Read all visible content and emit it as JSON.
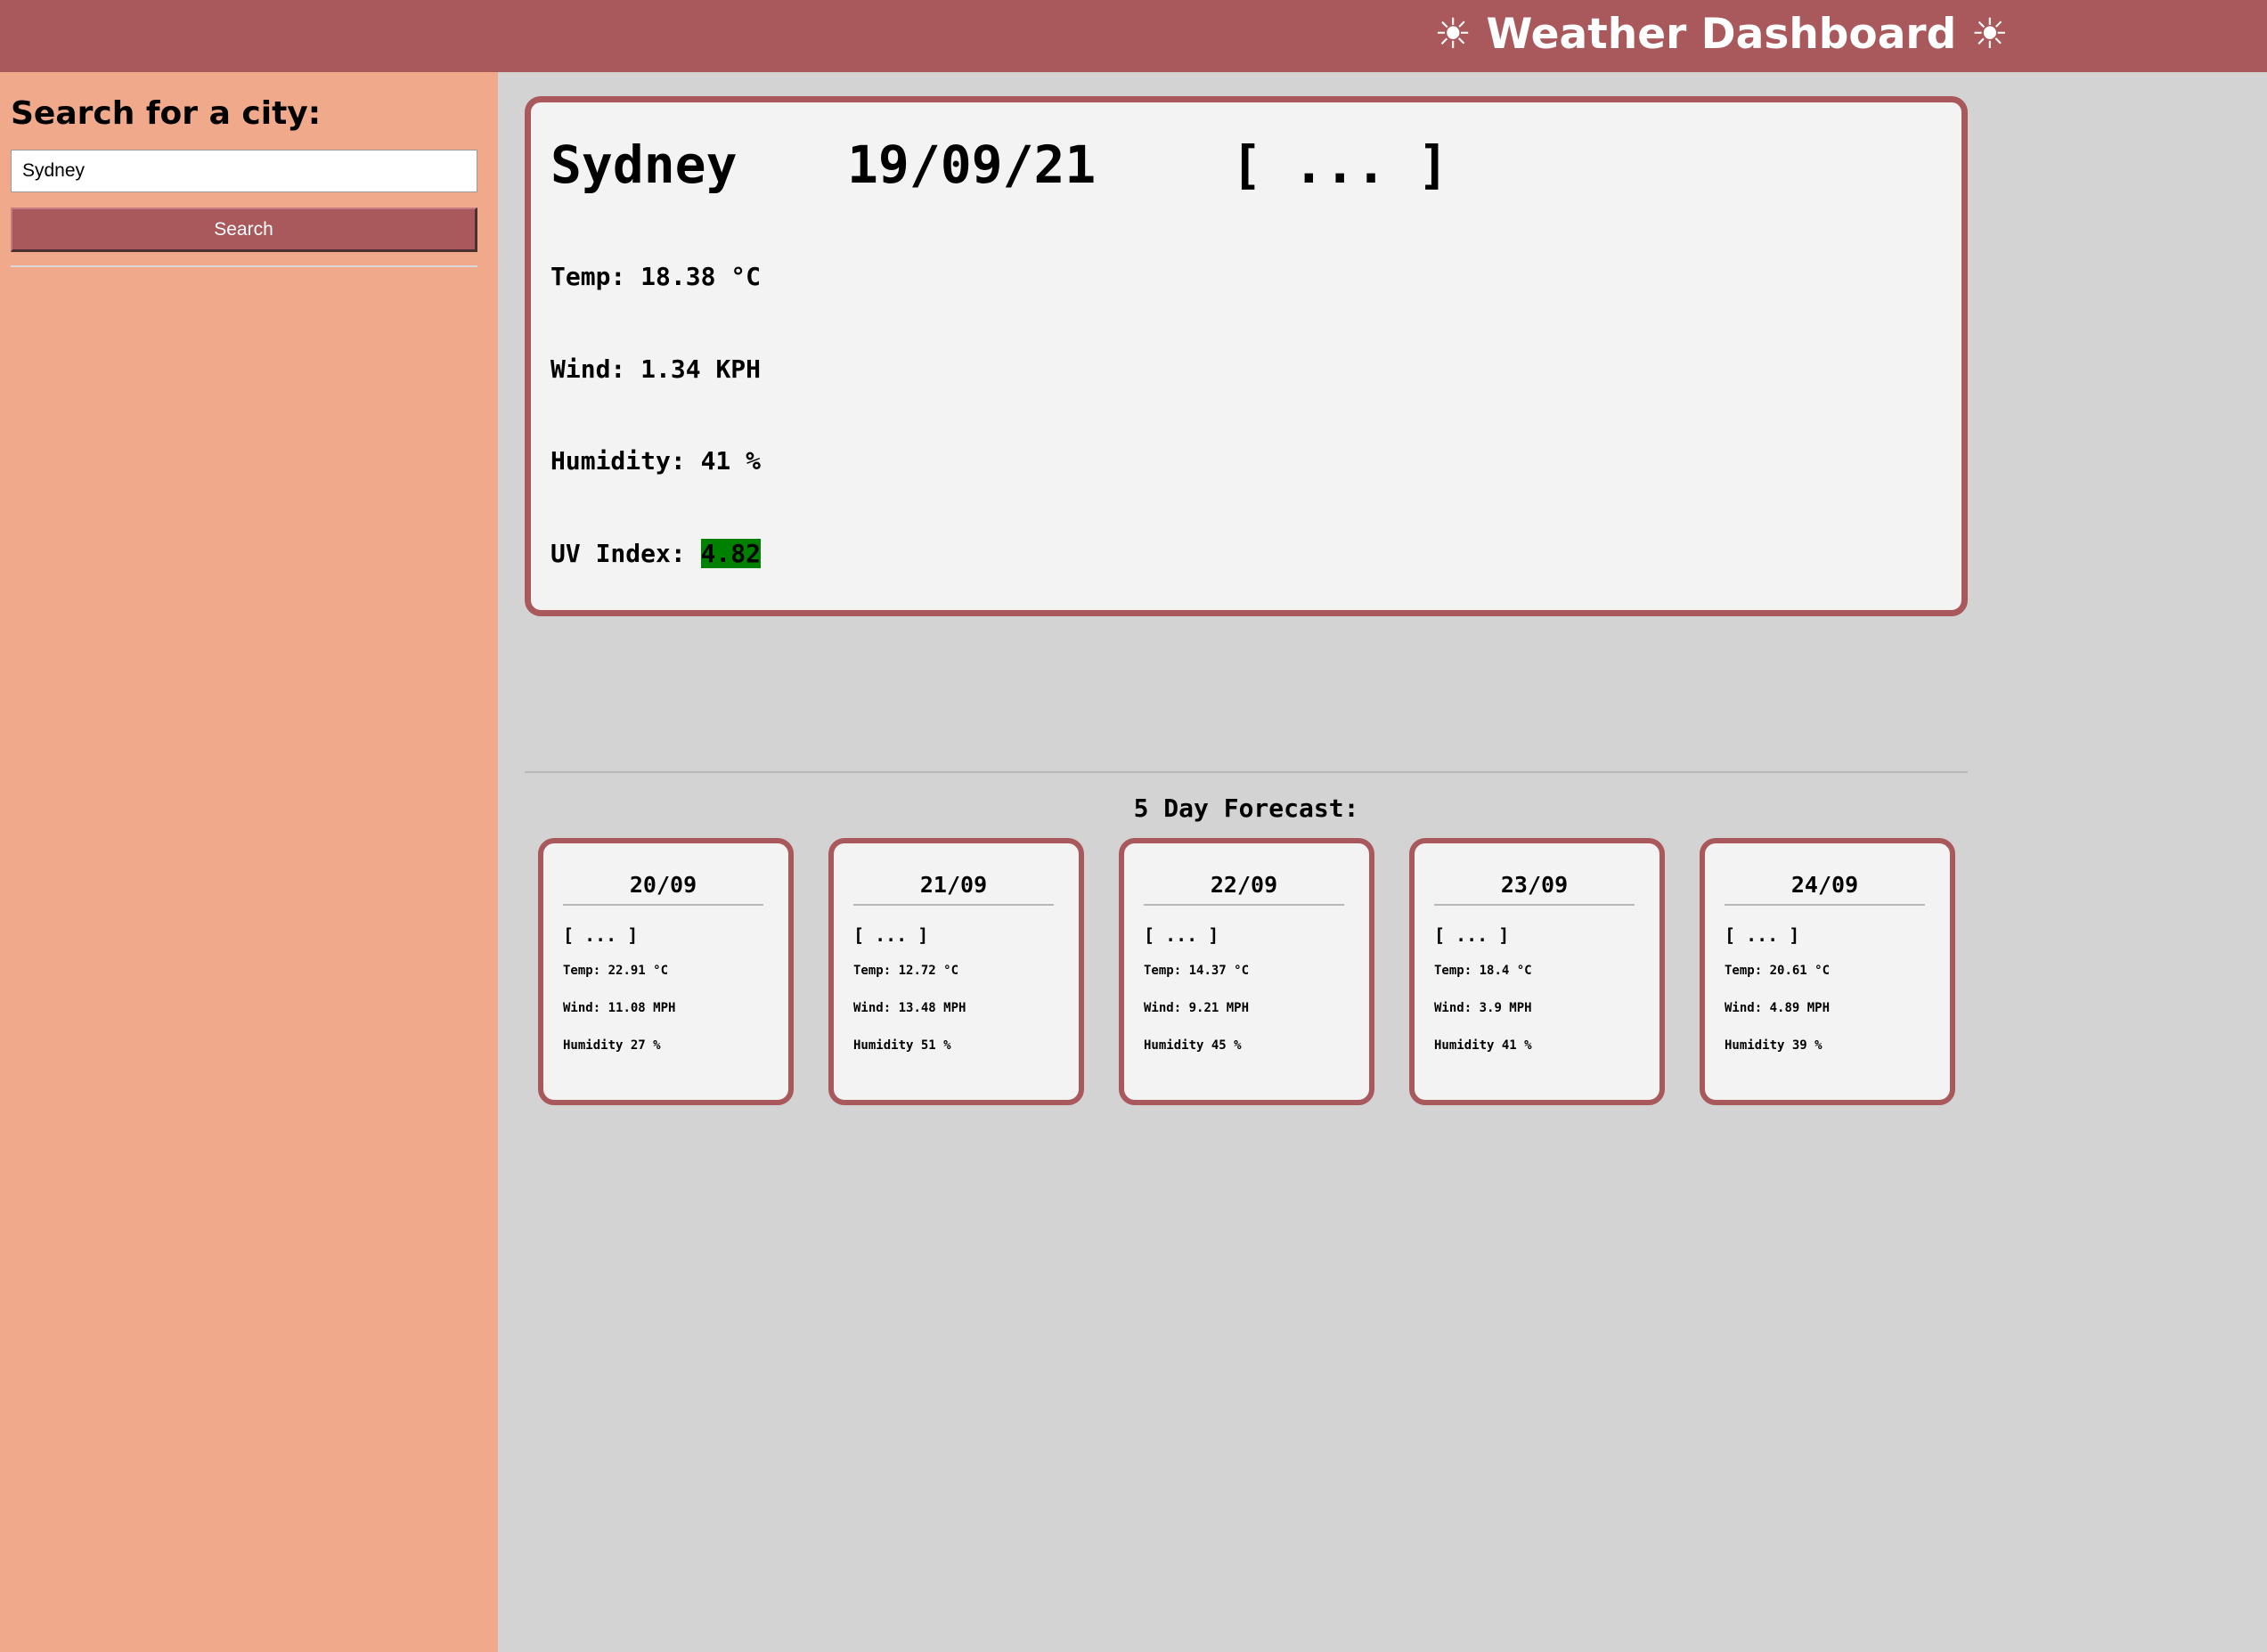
{
  "header": {
    "sun_left": "☀",
    "title": "Weather Dashboard",
    "sun_right": "☀"
  },
  "sidebar": {
    "heading": "Search for a city:",
    "search_value": "Sydney",
    "search_button": "Search"
  },
  "current": {
    "city": "Sydney",
    "date": "19/09/21",
    "icon_placeholder": "[ ... ]",
    "temp_label": "Temp:",
    "temp_value": "18.38 °C",
    "wind_label": "Wind:",
    "wind_value": "1.34 KPH",
    "humidity_label": "Humidity:",
    "humidity_value": "41 %",
    "uv_label": "UV Index:",
    "uv_value": "4.82",
    "uv_color": "#008000"
  },
  "forecast": {
    "heading": "5 Day Forecast:",
    "days": [
      {
        "date": "20/09",
        "icon": "[ ... ]",
        "temp_label": "Temp:",
        "temp": "22.91 °C",
        "wind_label": "Wind:",
        "wind": "11.08 MPH",
        "humidity_label": "Humidity",
        "humidity": "27 %"
      },
      {
        "date": "21/09",
        "icon": "[ ... ]",
        "temp_label": "Temp:",
        "temp": "12.72 °C",
        "wind_label": "Wind:",
        "wind": "13.48 MPH",
        "humidity_label": "Humidity",
        "humidity": "51 %"
      },
      {
        "date": "22/09",
        "icon": "[ ... ]",
        "temp_label": "Temp:",
        "temp": "14.37 °C",
        "wind_label": "Wind:",
        "wind": "9.21 MPH",
        "humidity_label": "Humidity",
        "humidity": "45 %"
      },
      {
        "date": "23/09",
        "icon": "[ ... ]",
        "temp_label": "Temp:",
        "temp": "18.4 °C",
        "wind_label": "Wind:",
        "wind": "3.9 MPH",
        "humidity_label": "Humidity",
        "humidity": "41 %"
      },
      {
        "date": "24/09",
        "icon": "[ ... ]",
        "temp_label": "Temp:",
        "temp": "20.61 °C",
        "wind_label": "Wind:",
        "wind": "4.89 MPH",
        "humidity_label": "Humidity",
        "humidity": "39 %"
      }
    ]
  },
  "colors": {
    "header_bg": "#a9585b",
    "sidebar_bg": "#f0a98b",
    "main_bg": "#d3d3d3",
    "card_bg": "#f3f3f3",
    "card_border": "#a9585b"
  }
}
